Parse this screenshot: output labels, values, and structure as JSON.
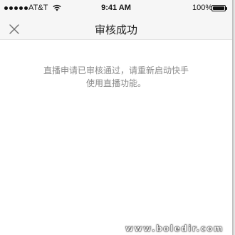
{
  "status_bar": {
    "carrier": "AT&T",
    "time": "9:41 AM",
    "battery_percent": "100%",
    "battery_level": 1.0,
    "icons": [
      "signal-dots-icon",
      "wifi-icon",
      "battery-icon"
    ]
  },
  "nav": {
    "title": "审核成功",
    "close_icon": "close-icon"
  },
  "message": {
    "line1": "直播申请已审核通过，请重新启动快手",
    "line2": "使用直播功能。"
  },
  "watermark": {
    "text": "www.boledir.com"
  },
  "colors": {
    "background": "#ffffff",
    "bar_background": "#f6f6f6",
    "message_text": "#8a8a8a",
    "title_text": "#222222"
  }
}
